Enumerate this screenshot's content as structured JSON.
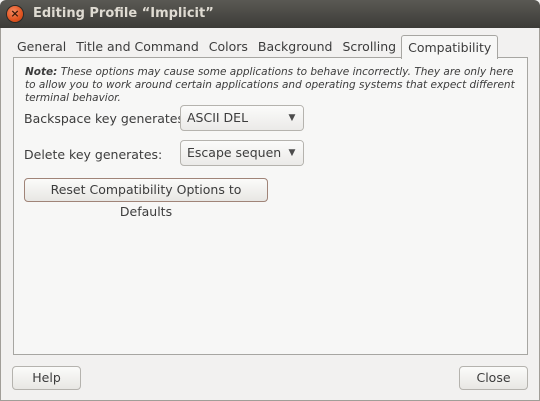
{
  "window": {
    "title": "Editing Profile “Implicit”",
    "close_glyph": "×"
  },
  "tabs": [
    {
      "label": "General"
    },
    {
      "label": "Title and Command"
    },
    {
      "label": "Colors"
    },
    {
      "label": "Background"
    },
    {
      "label": "Scrolling"
    },
    {
      "label": "Compatibility"
    }
  ],
  "active_tab": "Compatibility",
  "note": {
    "prefix": "Note:",
    "text": "These options may cause some applications to behave incorrectly.  They are only here to allow you to work around certain applications and operating systems that expect different terminal behavior."
  },
  "backspace": {
    "label": "Backspace key generates:",
    "value": "ASCII DEL"
  },
  "delete": {
    "label": "Delete key generates:",
    "value": "Escape sequence"
  },
  "reset_label": "Reset Compatibility Options to Defaults",
  "footer": {
    "help_label": "Help",
    "close_label": "Close"
  },
  "icons": {
    "close": "close-icon",
    "dropdown": "chevron-down-icon"
  }
}
